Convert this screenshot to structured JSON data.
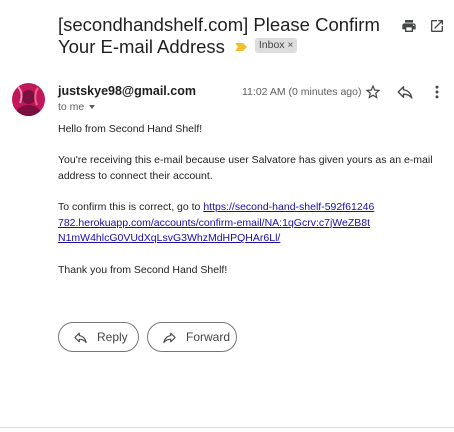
{
  "email": {
    "subject": "[secondhandshelf.com] Please Confirm Your E-mail Address",
    "label": "Inbox",
    "label_remove": "×",
    "sender": "justskye98@gmail.com",
    "recipient": "to me",
    "timestamp": "11:02 AM (0 minutes ago)",
    "body": {
      "greeting": "Hello from Second Hand Shelf!",
      "reason": "You're receiving this e-mail because user Salvatore has given yours as an e-mail address to connect their account.",
      "confirm_prefix": "To confirm this is correct, go to ",
      "confirm_link": "https://second-hand-shelf-592f61246782.herokuapp.com/accounts/confirm-email/NA:1qGcrv:c7jWeZB8tN1mW4hlcG0VUdXqLsvG3WhzMdHPQHAr6Ll/",
      "signoff": "Thank you from Second Hand Shelf!"
    }
  },
  "actions": {
    "reply_label": "Reply",
    "forward_label": "Forward"
  },
  "icons": {
    "print": "print-icon",
    "open_new_window": "open-in-new-window-icon",
    "star": "star-icon",
    "reply": "reply-icon",
    "more": "more-vert-icon",
    "importance": "importance-marker-icon"
  },
  "colors": {
    "link": "#1a0dab",
    "importance_marker": "#f2c029",
    "label_chip_bg": "#dddddd",
    "avatar_bg": "#c2185b"
  }
}
